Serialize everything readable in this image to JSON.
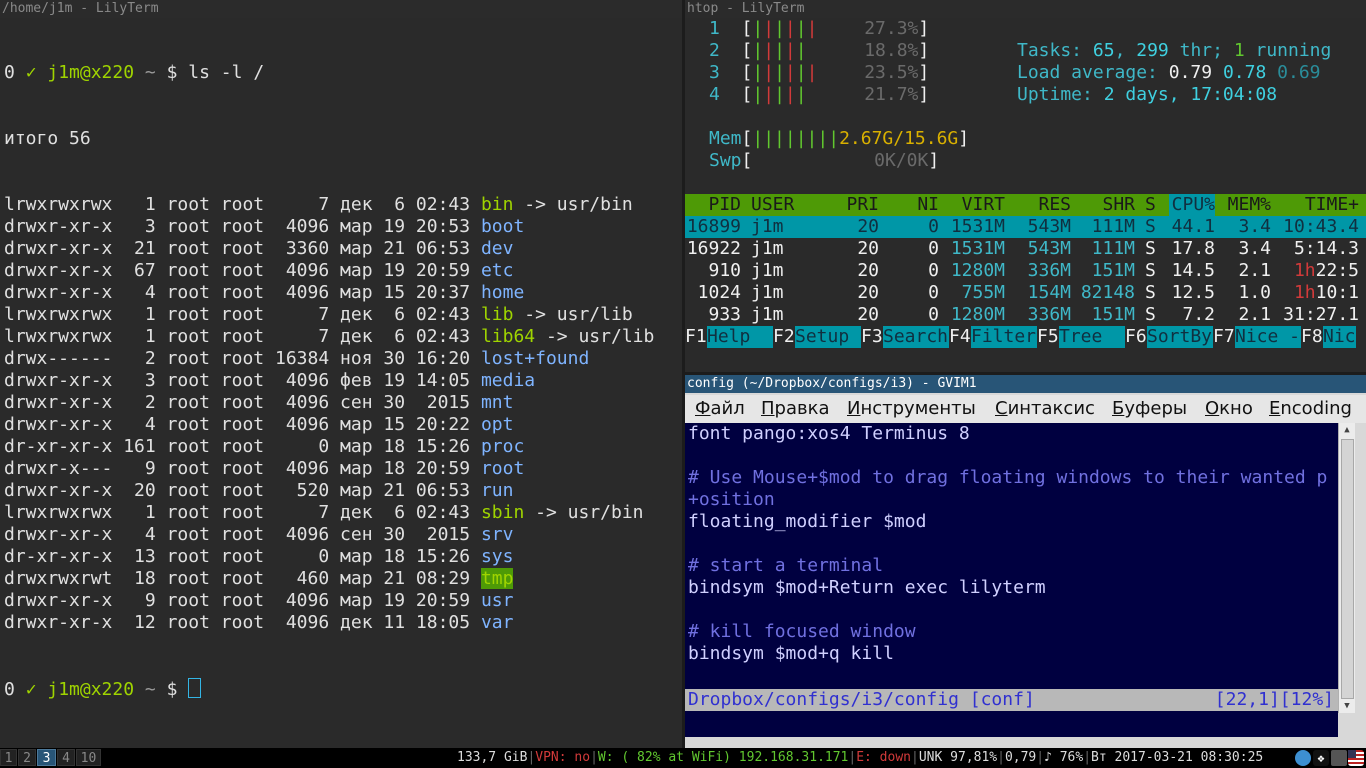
{
  "term1": {
    "title": "/home/j1m - LilyTerm",
    "prompt": {
      "status": "0",
      "check": "✓",
      "user_host": "j1m@x220",
      "cwd": "~",
      "dollar": "$",
      "command": "ls -l /"
    },
    "total": "итого 56",
    "rows": [
      {
        "perm": "lrwxrwxrwx",
        "links": "  1",
        "owner": "root",
        "group": "root",
        "size": "    7",
        "mon": "дек",
        "day": " 6",
        "time": "02:43",
        "name": "bin",
        "target": " -> usr/bin",
        "style": "green"
      },
      {
        "perm": "drwxr-xr-x",
        "links": "  3",
        "owner": "root",
        "group": "root",
        "size": " 4096",
        "mon": "мар",
        "day": "19",
        "time": "20:53",
        "name": "boot",
        "target": "",
        "style": "blue"
      },
      {
        "perm": "drwxr-xr-x",
        "links": " 21",
        "owner": "root",
        "group": "root",
        "size": " 3360",
        "mon": "мар",
        "day": "21",
        "time": "06:53",
        "name": "dev",
        "target": "",
        "style": "blue"
      },
      {
        "perm": "drwxr-xr-x",
        "links": " 67",
        "owner": "root",
        "group": "root",
        "size": " 4096",
        "mon": "мар",
        "day": "19",
        "time": "20:59",
        "name": "etc",
        "target": "",
        "style": "blue"
      },
      {
        "perm": "drwxr-xr-x",
        "links": "  4",
        "owner": "root",
        "group": "root",
        "size": " 4096",
        "mon": "мар",
        "day": "15",
        "time": "20:37",
        "name": "home",
        "target": "",
        "style": "blue"
      },
      {
        "perm": "lrwxrwxrwx",
        "links": "  1",
        "owner": "root",
        "group": "root",
        "size": "    7",
        "mon": "дек",
        "day": " 6",
        "time": "02:43",
        "name": "lib",
        "target": " -> usr/lib",
        "style": "green"
      },
      {
        "perm": "lrwxrwxrwx",
        "links": "  1",
        "owner": "root",
        "group": "root",
        "size": "    7",
        "mon": "дек",
        "day": " 6",
        "time": "02:43",
        "name": "lib64",
        "target": " -> usr/lib",
        "style": "green"
      },
      {
        "perm": "drwx------",
        "links": "  2",
        "owner": "root",
        "group": "root",
        "size": "16384",
        "mon": "ноя",
        "day": "30",
        "time": "16:20",
        "name": "lost+found",
        "target": "",
        "style": "blue"
      },
      {
        "perm": "drwxr-xr-x",
        "links": "  3",
        "owner": "root",
        "group": "root",
        "size": " 4096",
        "mon": "фев",
        "day": "19",
        "time": "14:05",
        "name": "media",
        "target": "",
        "style": "blue"
      },
      {
        "perm": "drwxr-xr-x",
        "links": "  2",
        "owner": "root",
        "group": "root",
        "size": " 4096",
        "mon": "сен",
        "day": "30",
        "time": " 2015",
        "name": "mnt",
        "target": "",
        "style": "blue"
      },
      {
        "perm": "drwxr-xr-x",
        "links": "  4",
        "owner": "root",
        "group": "root",
        "size": " 4096",
        "mon": "мар",
        "day": "15",
        "time": "20:22",
        "name": "opt",
        "target": "",
        "style": "blue"
      },
      {
        "perm": "dr-xr-xr-x",
        "links": "161",
        "owner": "root",
        "group": "root",
        "size": "    0",
        "mon": "мар",
        "day": "18",
        "time": "15:26",
        "name": "proc",
        "target": "",
        "style": "blue"
      },
      {
        "perm": "drwxr-x---",
        "links": "  9",
        "owner": "root",
        "group": "root",
        "size": " 4096",
        "mon": "мар",
        "day": "18",
        "time": "20:59",
        "name": "root",
        "target": "",
        "style": "blue"
      },
      {
        "perm": "drwxr-xr-x",
        "links": " 20",
        "owner": "root",
        "group": "root",
        "size": "  520",
        "mon": "мар",
        "day": "21",
        "time": "06:53",
        "name": "run",
        "target": "",
        "style": "blue"
      },
      {
        "perm": "lrwxrwxrwx",
        "links": "  1",
        "owner": "root",
        "group": "root",
        "size": "    7",
        "mon": "дек",
        "day": " 6",
        "time": "02:43",
        "name": "sbin",
        "target": " -> usr/bin",
        "style": "green"
      },
      {
        "perm": "drwxr-xr-x",
        "links": "  4",
        "owner": "root",
        "group": "root",
        "size": " 4096",
        "mon": "сен",
        "day": "30",
        "time": " 2015",
        "name": "srv",
        "target": "",
        "style": "blue"
      },
      {
        "perm": "dr-xr-xr-x",
        "links": " 13",
        "owner": "root",
        "group": "root",
        "size": "    0",
        "mon": "мар",
        "day": "18",
        "time": "15:26",
        "name": "sys",
        "target": "",
        "style": "blue"
      },
      {
        "perm": "drwxrwxrwt",
        "links": " 18",
        "owner": "root",
        "group": "root",
        "size": "  460",
        "mon": "мар",
        "day": "21",
        "time": "08:29",
        "name": "tmp",
        "target": "",
        "style": "tmp"
      },
      {
        "perm": "drwxr-xr-x",
        "links": "  9",
        "owner": "root",
        "group": "root",
        "size": " 4096",
        "mon": "мар",
        "day": "19",
        "time": "20:59",
        "name": "usr",
        "target": "",
        "style": "blue"
      },
      {
        "perm": "drwxr-xr-x",
        "links": " 12",
        "owner": "root",
        "group": "root",
        "size": " 4096",
        "mon": "дек",
        "day": "11",
        "time": "18:05",
        "name": "var",
        "target": "",
        "style": "blue"
      }
    ]
  },
  "htop": {
    "title": "htop - LilyTerm",
    "cpus": [
      {
        "num": "1",
        "bars": "||||||",
        "pct": "27.3%"
      },
      {
        "num": "2",
        "bars": "|||||",
        "pct": "18.8%"
      },
      {
        "num": "3",
        "bars": "||||||",
        "pct": "23.5%"
      },
      {
        "num": "4",
        "bars": "|||||",
        "pct": "21.7%"
      }
    ],
    "mem": {
      "label": "Mem",
      "bars": "||||||||",
      "value": "2.67G/15.6G"
    },
    "swp": {
      "label": "Swp",
      "value": "0K/0K"
    },
    "tasks": {
      "label": "Tasks:",
      "count": "65",
      "threads": "299",
      "thr_label": "thr;",
      "running": "1",
      "running_label": "running"
    },
    "load": {
      "label": "Load average:",
      "l1": "0.79",
      "l5": "0.78",
      "l15": "0.69"
    },
    "uptime": {
      "label": "Uptime:",
      "value": "2 days, 17:04:08"
    },
    "header": {
      "pid": "PID",
      "user": "USER",
      "pri": "PRI",
      "ni": "NI",
      "virt": "VIRT",
      "res": "RES",
      "shr": "SHR",
      "s": "S",
      "cpu": "CPU%",
      "mem": "MEM%",
      "time": "TIME+"
    },
    "processes": [
      {
        "pid": "16899",
        "user": "j1m",
        "pri": "20",
        "ni": "0",
        "virt": "1531M",
        "res": "543M",
        "shr": "111M",
        "s": "S",
        "cpu": "44.1",
        "mem": "3.4",
        "time_h": "",
        "time": "10:43.4"
      },
      {
        "pid": "16922",
        "user": "j1m",
        "pri": "20",
        "ni": "0",
        "virt": "1531M",
        "res": "543M",
        "shr": "111M",
        "s": "S",
        "cpu": "17.8",
        "mem": "3.4",
        "time_h": "",
        "time": "5:14.3"
      },
      {
        "pid": "910",
        "user": "j1m",
        "pri": "20",
        "ni": "0",
        "virt": "1280M",
        "res": "336M",
        "shr": "151M",
        "s": "S",
        "cpu": "14.5",
        "mem": "2.1",
        "time_h": "1h",
        "time": "22:5"
      },
      {
        "pid": "1024",
        "user": "j1m",
        "pri": "20",
        "ni": "0",
        "virt": "755M",
        "res": "154M",
        "shr": "82148",
        "s": "S",
        "cpu": "12.5",
        "mem": "1.0",
        "time_h": "1h",
        "time": "10:1"
      },
      {
        "pid": "933",
        "user": "j1m",
        "pri": "20",
        "ni": "0",
        "virt": "1280M",
        "res": "336M",
        "shr": "151M",
        "s": "S",
        "cpu": "7.2",
        "mem": "2.1",
        "time_h": "",
        "time": "31:27.1"
      }
    ],
    "fkeys": [
      {
        "key": "F1",
        "label": "Help  "
      },
      {
        "key": "F2",
        "label": "Setup "
      },
      {
        "key": "F3",
        "label": "Search"
      },
      {
        "key": "F4",
        "label": "Filter"
      },
      {
        "key": "F5",
        "label": "Tree  "
      },
      {
        "key": "F6",
        "label": "SortBy"
      },
      {
        "key": "F7",
        "label": "Nice -"
      },
      {
        "key": "F8",
        "label": "Nic"
      }
    ]
  },
  "gvim": {
    "title": "config (~/Dropbox/configs/i3) - GVIM1",
    "menu": [
      {
        "first": "Ф",
        "rest": "айл"
      },
      {
        "first": "П",
        "rest": "равка"
      },
      {
        "first": "И",
        "rest": "нструменты"
      },
      {
        "first": "С",
        "rest": "интаксис"
      },
      {
        "first": "Б",
        "rest": "уферы"
      },
      {
        "first": "О",
        "rest": "кно"
      },
      {
        "first": "E",
        "rest": "ncoding"
      }
    ],
    "lines": [
      {
        "text": "font pango:xos4 Terminus 8",
        "kind": "code"
      },
      {
        "text": "",
        "kind": "code"
      },
      {
        "text": "# Use Mouse+$mod to drag floating windows to their wanted p",
        "kind": "comment"
      },
      {
        "text": "+osition",
        "kind": "comment"
      },
      {
        "text": "floating_modifier $mod",
        "kind": "code"
      },
      {
        "text": "",
        "kind": "code"
      },
      {
        "text": "# start a terminal",
        "kind": "comment"
      },
      {
        "text": "bindsym $mod+Return exec lilyterm",
        "kind": "code"
      },
      {
        "text": "",
        "kind": "code"
      },
      {
        "text": "# kill focused window",
        "kind": "comment"
      },
      {
        "text": "bindsym $mod+q kill",
        "kind": "code"
      }
    ],
    "status_left": "Dropbox/configs/i3/config [conf]",
    "status_right": "[22,1][12%]"
  },
  "bar": {
    "workspaces": [
      {
        "label": "1",
        "active": false
      },
      {
        "label": "2",
        "active": false
      },
      {
        "label": "3",
        "active": true
      },
      {
        "label": "4",
        "active": false
      },
      {
        "label": "10",
        "active": false
      }
    ],
    "disk": "133,7 GiB",
    "vpn": "VPN: no",
    "wifi_prefix": "W: ( 82% at WiFi)",
    "wifi_ip": "192.168.31.171",
    "eth": "E: down",
    "battery": "UNK 97,81%",
    "load": "0,79",
    "volume": "♪ 76%",
    "datetime": "Вт 2017-03-21 08:30:25",
    "colors": {
      "red": "#d23a3a",
      "green": "#61c82f",
      "text": "#dddddd"
    },
    "tray_icons": [
      "network-tray-icon",
      "dropbox-tray-icon",
      "audio-tray-icon",
      "us-flag-tray-icon"
    ]
  }
}
